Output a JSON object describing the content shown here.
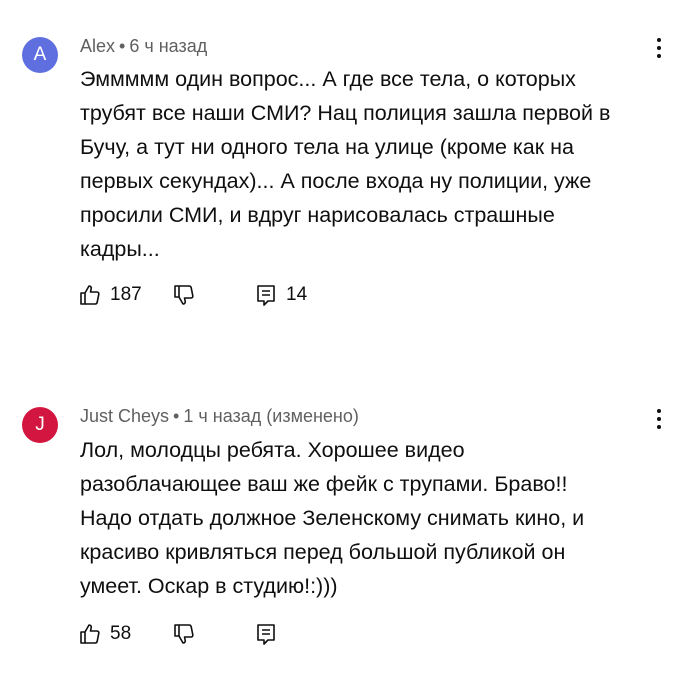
{
  "comments": [
    {
      "avatar_letter": "A",
      "avatar_color": "#5f6fe0",
      "author": "Alex",
      "separator": "•",
      "time": "6 ч назад",
      "text_lines": [
        "Эммммм один вопрос... А где все тела, о которых",
        "трубят все наши СМИ? Нац полиция зашла первой в",
        "Бучу, а тут ни одного тела на улице (кроме как на",
        "первых секундах)... А после входа ну полиции, уже",
        "просили СМИ, и вдруг нарисовалась страшные",
        "кадры..."
      ],
      "likes": "187",
      "replies": "14",
      "icons": {
        "like": "thumbs-up-icon",
        "dislike": "thumbs-down-icon",
        "reply": "reply-icon",
        "menu": "more-vert-icon"
      }
    },
    {
      "avatar_letter": "J",
      "avatar_color": "#d3163f",
      "author": "Just Cheys",
      "separator": "•",
      "time": "1 ч назад (изменено)",
      "text_lines": [
        "Лол, молодцы ребята. Хорошее видео",
        "разоблачающее ваш же фейк с трупами. Браво!!",
        "Надо отдать должное Зеленскому снимать кино, и",
        "красиво кривляться перед большой публикой он",
        "умеет. Оскар в студию!:)))"
      ],
      "likes": "58",
      "replies": "",
      "icons": {
        "like": "thumbs-up-icon",
        "dislike": "thumbs-down-icon",
        "reply": "reply-icon",
        "menu": "more-vert-icon"
      }
    }
  ]
}
